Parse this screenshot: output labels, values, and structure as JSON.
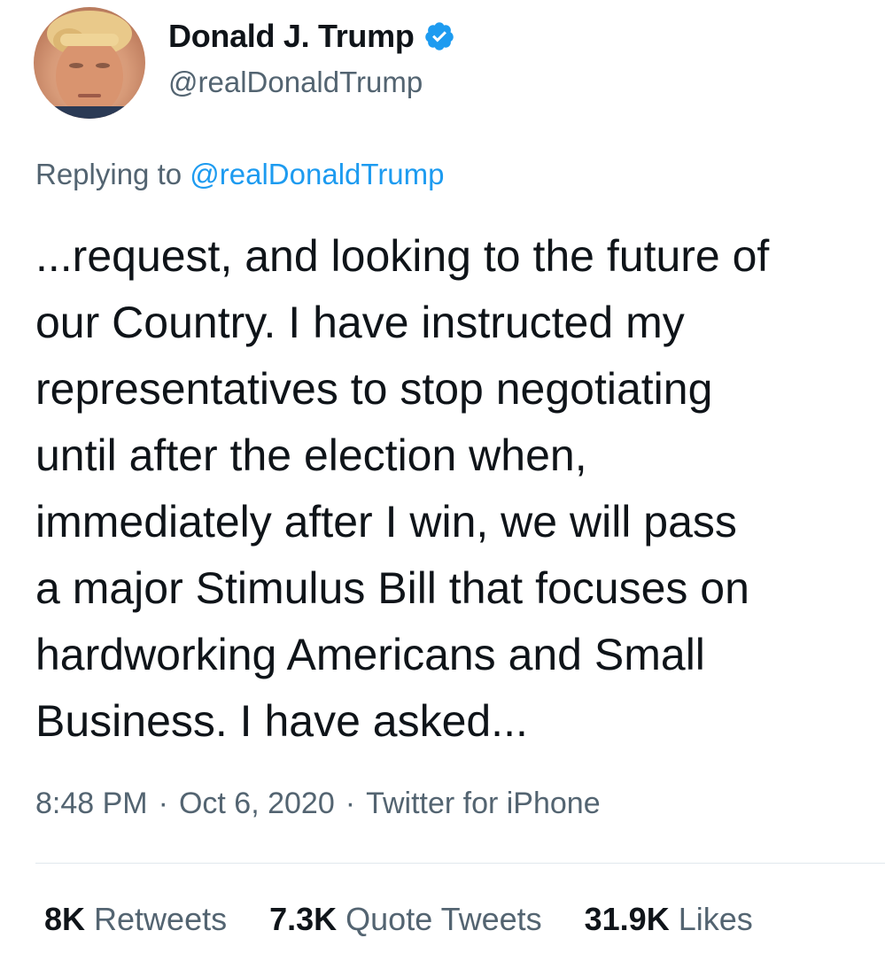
{
  "author": {
    "display_name": "Donald J. Trump",
    "handle": "@realDonaldTrump",
    "verified_icon": "verified-badge-icon"
  },
  "reply": {
    "prefix": "Replying to",
    "mention": "@realDonaldTrump"
  },
  "tweet": {
    "text": "...request, and looking to the future of\nour Country. I have instructed my\nrepresentatives to stop negotiating\nuntil after the election when,\nimmediately after I win, we will pass\na major Stimulus Bill that focuses on\nhardworking Americans and Small\nBusiness. I have asked..."
  },
  "meta": {
    "time": "8:48 PM",
    "date": "Oct 6, 2020",
    "source": "Twitter for iPhone"
  },
  "stats": {
    "retweets": {
      "count": "8K",
      "label": "Retweets"
    },
    "quotes": {
      "count": "7.3K",
      "label": "Quote Tweets"
    },
    "likes": {
      "count": "31.9K",
      "label": "Likes"
    }
  },
  "colors": {
    "accent": "#1d9bf0",
    "text": "#0f1419",
    "secondary": "#536471",
    "divider": "#e1e8ed"
  }
}
